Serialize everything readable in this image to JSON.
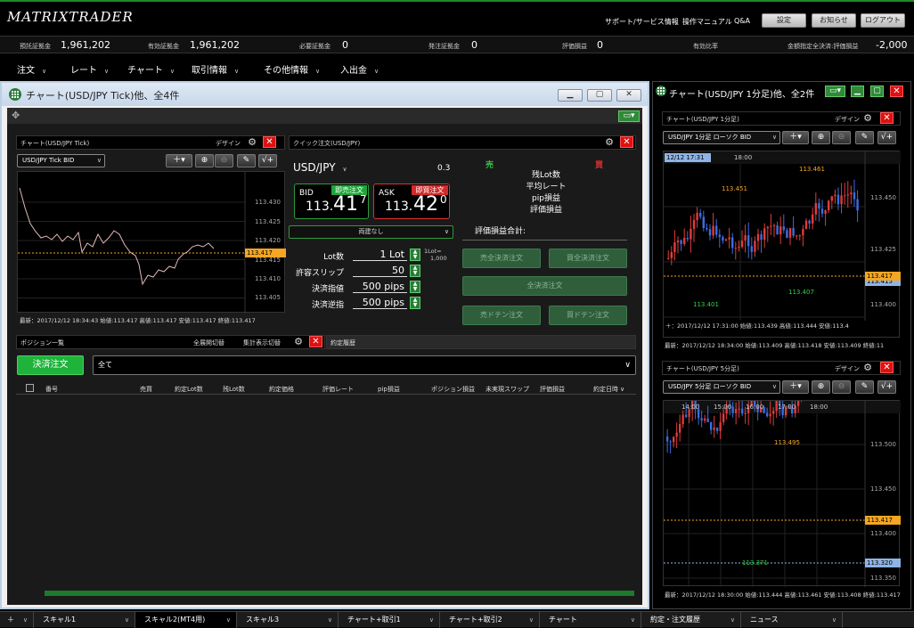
{
  "app": {
    "logo": "MATRIXTRADER"
  },
  "top_links": [
    "サポート/サービス情報",
    "操作マニュアル",
    "Q&A"
  ],
  "top_buttons": [
    "設定",
    "お知らせ",
    "ログアウト"
  ],
  "account": [
    {
      "label": "預託証拠金",
      "value": "1,961,202"
    },
    {
      "label": "有効証拠金",
      "value": "1,961,202"
    },
    {
      "label": "必要証拠金",
      "value": "0"
    },
    {
      "label": "発注証拠金",
      "value": "0"
    },
    {
      "label": "評価損益",
      "value": "0"
    },
    {
      "label": "有効比率",
      "value": ""
    },
    {
      "label": "金額指定全決済:評価損益",
      "value": "-2,000"
    }
  ],
  "menu": [
    "注文",
    "レート",
    "チャート",
    "取引情報",
    "その他情報",
    "入出金"
  ],
  "main_window": {
    "title": "チャート(USD/JPY Tick)他、全4件"
  },
  "tick_chart": {
    "header": "チャート(USD/JPY Tick)",
    "design_label": "デザイン",
    "selector": "USD/JPY  Tick  BID",
    "footer": "最新：2017/12/12 18:34:43  始値:113.417  高値:113.417  安値:113.417  終値:113.417",
    "price_tag": "113.417"
  },
  "quick_order": {
    "header": "クイック注文(USD/JPY)",
    "pair": "USD/JPY",
    "spread": "0.3",
    "bid_label": "BID",
    "bid_btn": "即売注文",
    "bid_price_small": "113.",
    "bid_price_big": "41",
    "bid_price_sup": "7",
    "ask_label": "ASK",
    "ask_btn": "即買注文",
    "ask_price_small": "113.",
    "ask_price_big": "42",
    "ask_price_sup": "0",
    "both_select": "両建なし",
    "lot_label": "Lot数",
    "lot_value": "1 Lot",
    "lot_note1": "1Lot=",
    "lot_note2": "1,000",
    "slip_label": "許容スリップ",
    "slip_value": "50",
    "limit_label": "決済指値",
    "limit_value": "500 pips",
    "stop_label": "決済逆指",
    "stop_value": "500 pips",
    "sell_head": "売",
    "buy_head": "買",
    "info_rows": [
      "残Lot数",
      "平均レート",
      "pip損益",
      "評価損益"
    ],
    "total_label": "評価損益合計:",
    "btn_sell_all": "売全決済注文",
    "btn_buy_all": "買全決済注文",
    "btn_all": "全決済注文",
    "btn_sell_doten": "売ドテン注文",
    "btn_buy_doten": "買ドテン注文"
  },
  "positions": {
    "tab": "ポジション一覧",
    "expand_toggle": "全展開切替",
    "summary_toggle": "集計表示切替",
    "history_tab": "約定履歴",
    "settle_btn": "決済注文",
    "filter_value": "全て",
    "columns": [
      "番号",
      "売買",
      "約定Lot数",
      "残Lot数",
      "約定価格",
      "評価レート",
      "pip損益",
      "ポジション損益",
      "未実現スワップ",
      "評価損益",
      "約定日時"
    ]
  },
  "side_window": {
    "title": "チャート(USD/JPY 1分足)他、全2件"
  },
  "chart1": {
    "header": "チャート(USD/JPY 1分足)",
    "design_label": "デザイン",
    "selector": "USD/JPY  1分足  ローソク  BID",
    "time_tag": "12/12 17:31",
    "x_label": "18:00",
    "price_tag": "113.417",
    "price_tag2": "113.415",
    "cross_label": "＋：2017/12/12 17:31:00  始値:113.439  高値:113.444  安値:113.4",
    "footer": "最新：2017/12/12 18:34:00  始値:113.409  高値:113.418  安値:113.409  終値:11",
    "marker_high1": "113.451",
    "marker_high2": "113.461",
    "marker_low1": "113.401",
    "marker_low2": "113.407",
    "y_labels": [
      "113.450",
      "113.425",
      "113.400"
    ]
  },
  "chart5": {
    "header": "チャート(USD/JPY 5分足)",
    "design_label": "デザイン",
    "selector": "USD/JPY  5分足  ローソク  BID",
    "x_labels": [
      "14:00",
      "15:00",
      "16:00",
      "17:00",
      "18:00"
    ],
    "price_tag": "113.417",
    "price_tag2": "113.320",
    "footer": "最新：2017/12/12 18:30:00  始値:113.444  高値:113.461  安値:113.408  終値:113.417",
    "marker_high": "113.495",
    "marker_low": "113.371",
    "y_labels": [
      "113.500",
      "113.450",
      "113.400",
      "113.350"
    ]
  },
  "tick_y_labels": [
    "113.430",
    "113.425",
    "113.420",
    "113.415",
    "113.410",
    "113.405"
  ],
  "taskbar": [
    "スキャル1",
    "スキャル2(MT4用)",
    "スキャル3",
    "チャート+取引1",
    "チャート+取引2",
    "チャート",
    "約定・注文履歴",
    "ニュース"
  ],
  "colors": {
    "accent_green": "#1f8a2a",
    "up_candle": "#e23b3b",
    "down_candle": "#3b6de2",
    "price_tag": "#f5a623"
  }
}
